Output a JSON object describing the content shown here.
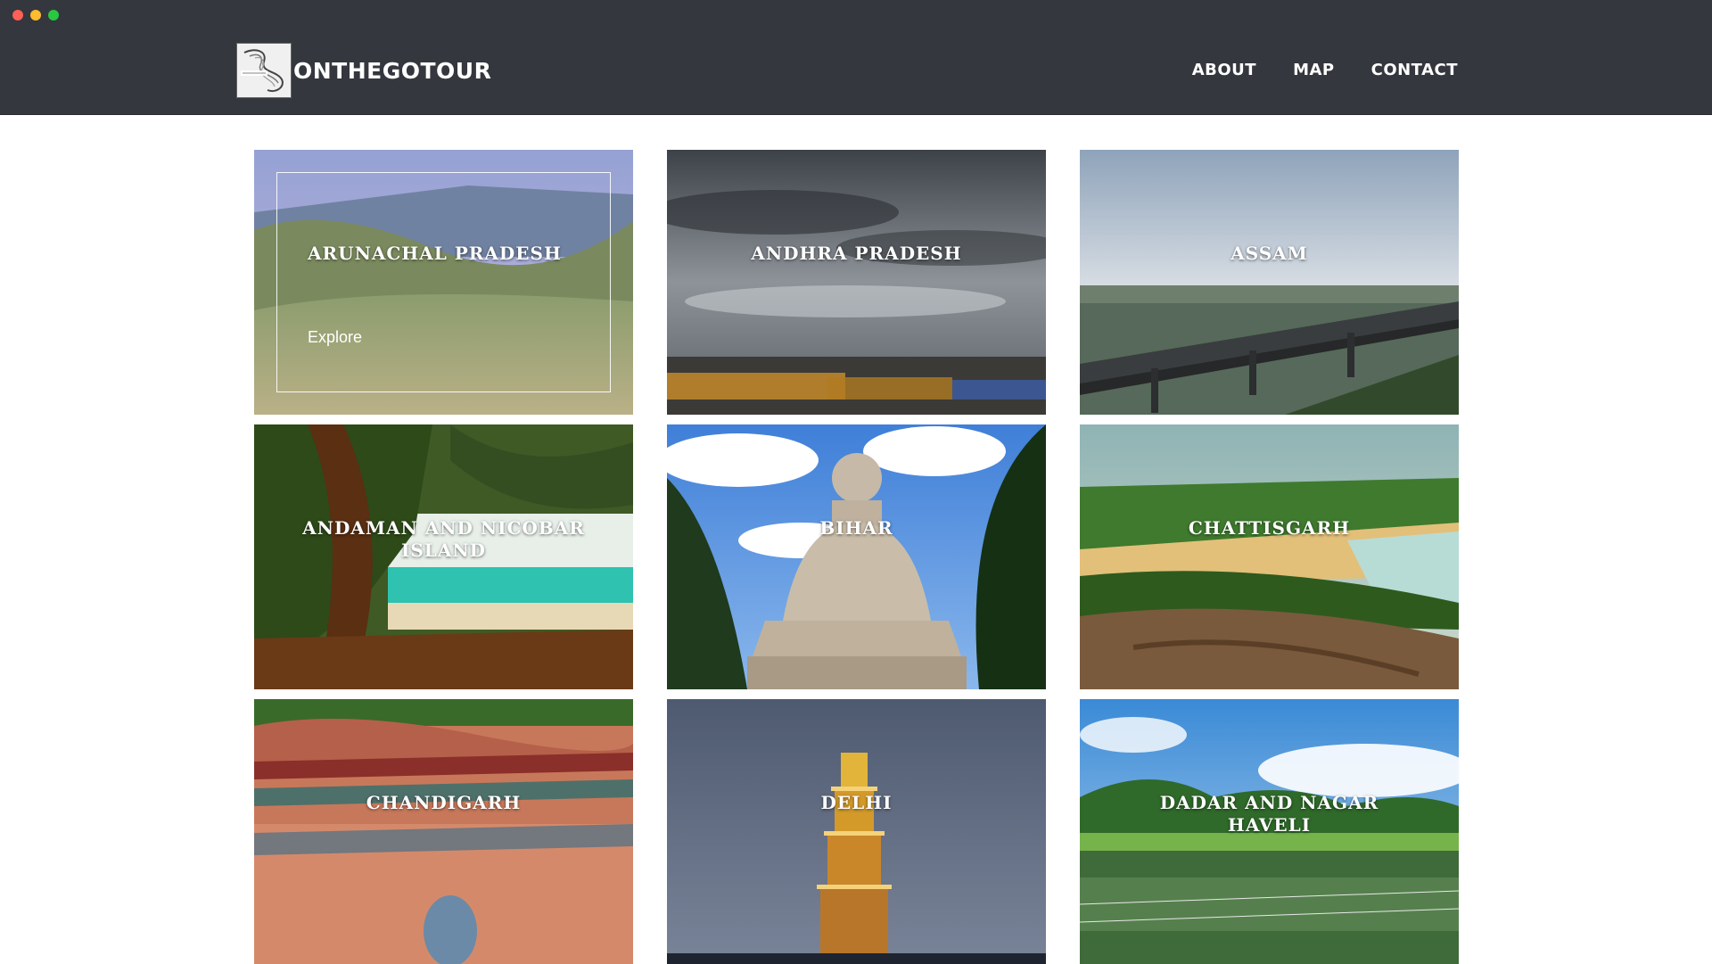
{
  "brand": {
    "name": "ONTHEGOTOUR",
    "logo_icon": "scroll-logo-icon"
  },
  "nav": {
    "items": [
      {
        "label": "ABOUT"
      },
      {
        "label": "MAP"
      },
      {
        "label": "CONTACT"
      }
    ]
  },
  "cards": [
    {
      "title": "ARUNACHAL PRADESH",
      "action": "Explore"
    },
    {
      "title": "ANDHRA PRADESH"
    },
    {
      "title": "ASSAM"
    },
    {
      "title": "ANDAMAN AND NICOBAR ISLAND"
    },
    {
      "title": "BIHAR"
    },
    {
      "title": "CHATTISGARH"
    },
    {
      "title": "CHANDIGARH"
    },
    {
      "title": "DELHI"
    },
    {
      "title": "DADAR AND NAGAR HAVELI"
    }
  ],
  "colors": {
    "header": "#34373d",
    "background": "#ffffff",
    "text": "#ffffff"
  }
}
